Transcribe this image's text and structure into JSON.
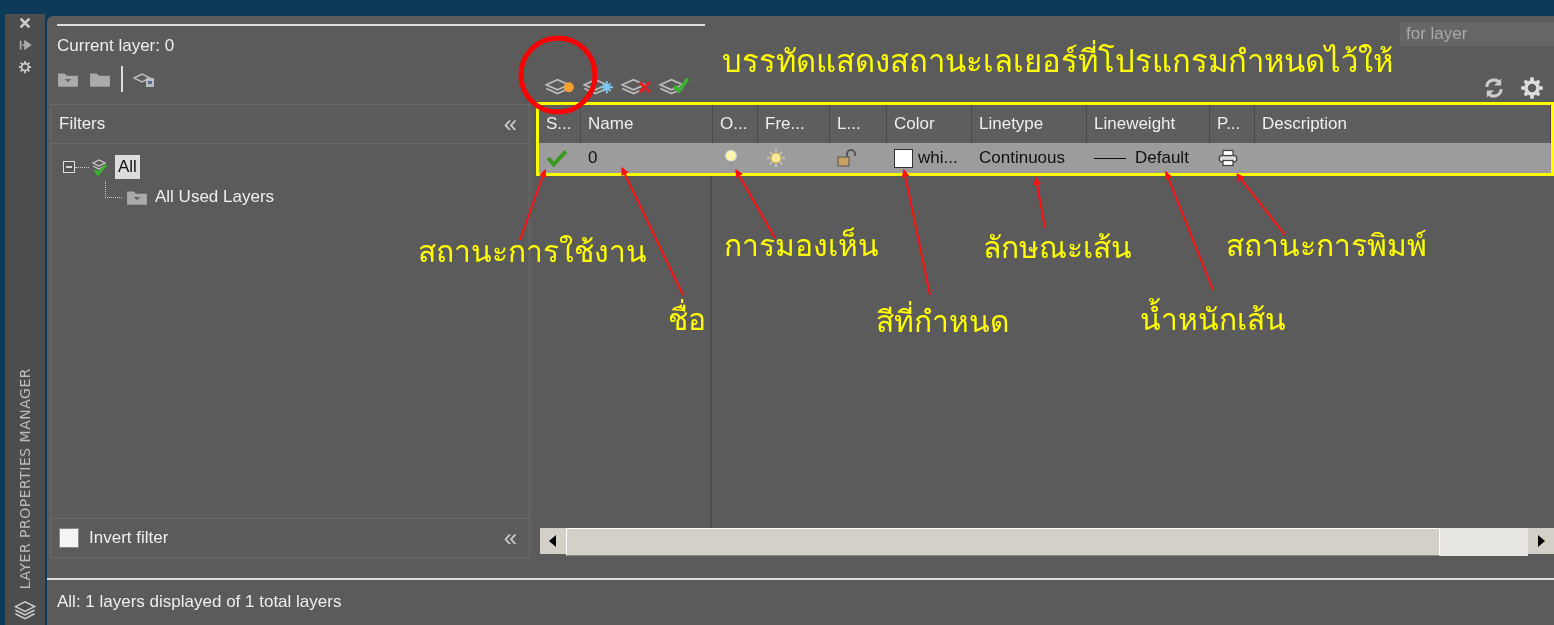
{
  "side_strip": {
    "title": "LAYER PROPERTIES MANAGER"
  },
  "current_layer": "Current layer: 0",
  "search": {
    "placeholder": "for layer"
  },
  "filters": {
    "heading": "Filters",
    "collapse": "«",
    "tree": [
      {
        "label": "All",
        "selected": true,
        "expanded": true,
        "children": [
          {
            "label": "All Used Layers",
            "selected": false
          }
        ]
      }
    ],
    "invert_filter": {
      "label": "Invert filter",
      "checked": false,
      "collapse": "«"
    }
  },
  "table": {
    "columns": [
      "S...",
      "Name",
      "O...",
      "Fre...",
      "L...",
      "Color",
      "Linetype",
      "Lineweight",
      "P...",
      "Description"
    ],
    "rows": [
      {
        "current": true,
        "name": "0",
        "on": true,
        "frozen": false,
        "locked": false,
        "color": "#ffffff",
        "color_name": "whi...",
        "linetype": "Continuous",
        "lineweight": "Default",
        "plot": true,
        "selected": true
      }
    ]
  },
  "status_bar": "All: 1 layers displayed of 1 total layers",
  "annotations": {
    "caption": "บรรทัดแสดงสถานะเลเยอร์ที่โปรแกรมกำหนดไว้ให้",
    "labels": [
      "สถานะการใช้งาน",
      "ชื่อ",
      "การมองเห็น",
      "สีที่กำหนด",
      "ลักษณะเส้น",
      "น้ำหนักเส้น",
      "สถานะการพิมพ์"
    ]
  }
}
